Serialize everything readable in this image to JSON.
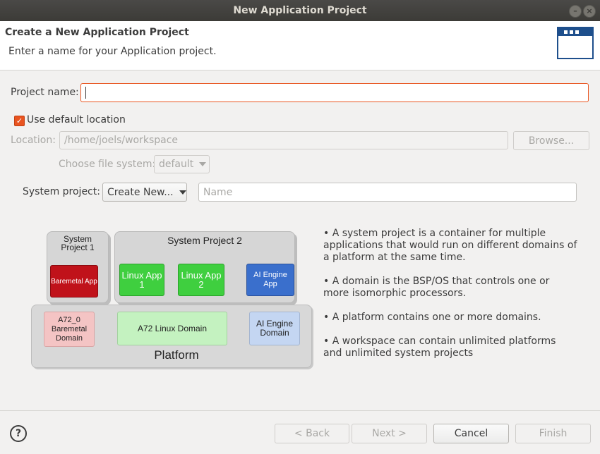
{
  "window": {
    "title": "New Application Project"
  },
  "header": {
    "title": "Create a New Application Project",
    "subtitle": "Enter a name for your Application project."
  },
  "form": {
    "project_name_label": "Project name:",
    "project_name_value": "",
    "use_default_location_label": "Use default location",
    "use_default_location_checked": true,
    "location_label": "Location:",
    "location_value": "/home/joels/workspace",
    "browse_label": "Browse...",
    "file_system_label": "Choose file system:",
    "file_system_value": "default",
    "system_project_label": "System project:",
    "system_project_value": "Create New...",
    "system_project_name_placeholder": "Name"
  },
  "diagram": {
    "system_project_1": "System Project 1",
    "system_project_2": "System Project 2",
    "baremetal_app": "Baremetal App",
    "linux_app_1": "Linux App 1",
    "linux_app_2": "Linux App 2",
    "ai_engine_app": "AI Engine App",
    "a72_0_baremetal_domain": "A72_0 Baremetal Domain",
    "a72_linux_domain": "A72 Linux Domain",
    "ai_engine_domain": "AI Engine Domain",
    "platform": "Platform"
  },
  "info": {
    "bullets": [
      "• A system project is a container for multiple applications that would run on different domains of a platform at the same time.",
      "• A domain is the BSP/OS that controls one or more isomorphic processors.",
      "• A platform contains one or more domains.",
      "• A workspace can contain unlimited platforms and unlimited system projects"
    ]
  },
  "footer": {
    "help_label": "?",
    "back_label": "< Back",
    "next_label": "Next >",
    "cancel_label": "Cancel",
    "finish_label": "Finish"
  },
  "colors": {
    "accent": "#e95420",
    "titlebar": "#3c3b37",
    "header_bg": "#ffffff"
  }
}
